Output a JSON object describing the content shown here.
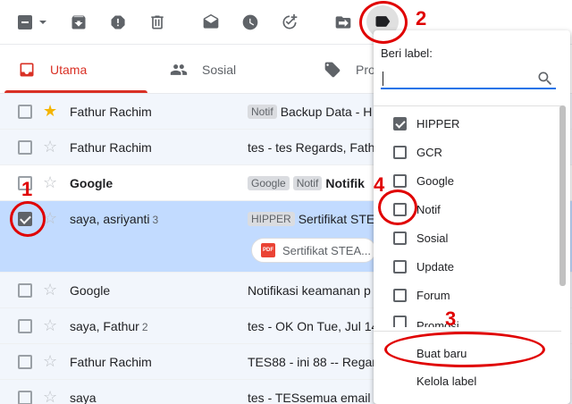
{
  "tabs": [
    {
      "label": "Utama",
      "icon": "inbox-icon"
    },
    {
      "label": "Sosial",
      "icon": "people-icon"
    },
    {
      "label": "Pro",
      "icon": "tag-icon"
    }
  ],
  "emails": [
    {
      "sender": "Fathur Rachim",
      "count": "",
      "starred": true,
      "checked": false,
      "unread": false,
      "chips": [
        "Notif"
      ],
      "subject": "Backup Data - H",
      "bold_subject": ""
    },
    {
      "sender": "Fathur Rachim",
      "count": "",
      "starred": false,
      "checked": false,
      "unread": false,
      "chips": [],
      "subject": "tes - tes Regards, Fath",
      "bold_subject": ""
    },
    {
      "sender": "Google",
      "count": "",
      "starred": false,
      "checked": false,
      "unread": true,
      "chips": [
        "Google",
        "Notif"
      ],
      "subject": "",
      "bold_subject": "Notifik"
    },
    {
      "sender": "saya, asriyanti",
      "count": "3",
      "starred": false,
      "checked": true,
      "unread": false,
      "chips": [
        "HIPPER"
      ],
      "subject": "Sertifikat STE",
      "bold_subject": "",
      "attachment": "Sertifikat STEA..."
    },
    {
      "sender": "Google",
      "count": "",
      "starred": false,
      "checked": false,
      "unread": false,
      "chips": [],
      "subject": "Notifikasi keamanan p",
      "bold_subject": ""
    },
    {
      "sender": "saya, Fathur",
      "count": "2",
      "starred": false,
      "checked": false,
      "unread": false,
      "chips": [],
      "subject": "tes - OK On Tue, Jul 14",
      "bold_subject": ""
    },
    {
      "sender": "Fathur Rachim",
      "count": "",
      "starred": false,
      "checked": false,
      "unread": false,
      "chips": [],
      "subject": "TES88 - ini 88 -- Regar",
      "bold_subject": ""
    },
    {
      "sender": "saya",
      "count": "",
      "starred": false,
      "checked": false,
      "unread": false,
      "chips": [],
      "subject": "tes - TESsemua email",
      "bold_subject": ""
    }
  ],
  "label_menu": {
    "title": "Beri label:",
    "search_value": "",
    "labels": [
      {
        "name": "HIPPER",
        "checked": true
      },
      {
        "name": "GCR",
        "checked": false
      },
      {
        "name": "Google",
        "checked": false
      },
      {
        "name": "Notif",
        "checked": false
      },
      {
        "name": "Sosial",
        "checked": false
      },
      {
        "name": "Update",
        "checked": false
      },
      {
        "name": "Forum",
        "checked": false
      },
      {
        "name": "Promosi",
        "checked": false
      }
    ],
    "create_new": "Buat baru",
    "manage": "Kelola label"
  },
  "annotations": {
    "n1": "1",
    "n2": "2",
    "n3": "3",
    "n4": "4",
    "color": "#e00000"
  },
  "colors": {
    "accent": "#d93025",
    "selected_row": "#c2dbff",
    "focus_line": "#1a73e8"
  }
}
